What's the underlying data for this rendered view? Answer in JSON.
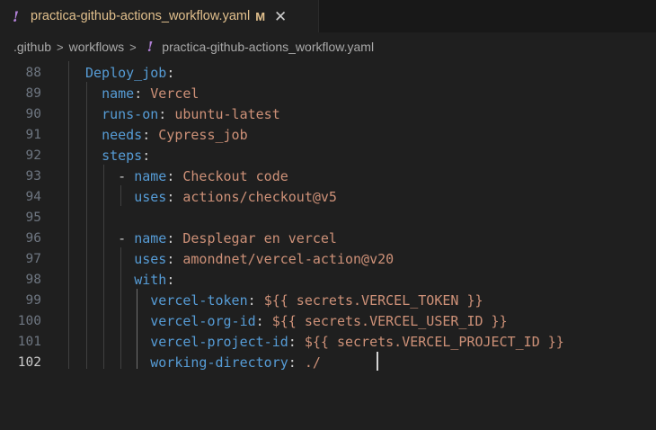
{
  "tab": {
    "icon": "!",
    "title": "practica-github-actions_workflow.yaml",
    "modified": "M",
    "close": "✕"
  },
  "breadcrumb": {
    "items": [
      ".github",
      "workflows"
    ],
    "separator": ">",
    "file_icon": "!",
    "file": "practica-github-actions_workflow.yaml"
  },
  "colors": {
    "background": "#1f1f1f",
    "key": "#569cd6",
    "value": "#ce9178",
    "modified": "#e2c08d",
    "yaml_icon": "#b180d7"
  },
  "editor": {
    "lines": [
      {
        "num": "88",
        "indent": "",
        "key": "Deploy_job",
        "sep": ":",
        "value": ""
      },
      {
        "num": "89",
        "indent": "  ",
        "key": "name",
        "sep": ": ",
        "value": "Vercel"
      },
      {
        "num": "90",
        "indent": "  ",
        "key": "runs-on",
        "sep": ": ",
        "value": "ubuntu-latest"
      },
      {
        "num": "91",
        "indent": "  ",
        "key": "needs",
        "sep": ": ",
        "value": "Cypress_job"
      },
      {
        "num": "92",
        "indent": "  ",
        "key": "steps",
        "sep": ":",
        "value": ""
      },
      {
        "num": "93",
        "indent": "    - ",
        "key": "name",
        "sep": ": ",
        "value": "Checkout code"
      },
      {
        "num": "94",
        "indent": "      ",
        "key": "uses",
        "sep": ": ",
        "value": "actions/checkout@v5"
      },
      {
        "num": "95",
        "indent": "",
        "key": "",
        "sep": "",
        "value": ""
      },
      {
        "num": "96",
        "indent": "    - ",
        "key": "name",
        "sep": ": ",
        "value": "Desplegar en vercel"
      },
      {
        "num": "97",
        "indent": "      ",
        "key": "uses",
        "sep": ": ",
        "value": "amondnet/vercel-action@v20"
      },
      {
        "num": "98",
        "indent": "      ",
        "key": "with",
        "sep": ":",
        "value": ""
      },
      {
        "num": "99",
        "indent": "        ",
        "key": "vercel-token",
        "sep": ": ",
        "value": "${{ secrets.VERCEL_TOKEN }}"
      },
      {
        "num": "100",
        "indent": "        ",
        "key": "vercel-org-id",
        "sep": ": ",
        "value": "${{ secrets.VERCEL_USER_ID }}"
      },
      {
        "num": "101",
        "indent": "        ",
        "key": "vercel-project-id",
        "sep": ": ",
        "value": "${{ secrets.VERCEL_PROJECT_ID }}"
      },
      {
        "num": "102",
        "indent": "        ",
        "key": "working-directory",
        "sep": ": ",
        "value": "./",
        "active": true
      }
    ]
  }
}
